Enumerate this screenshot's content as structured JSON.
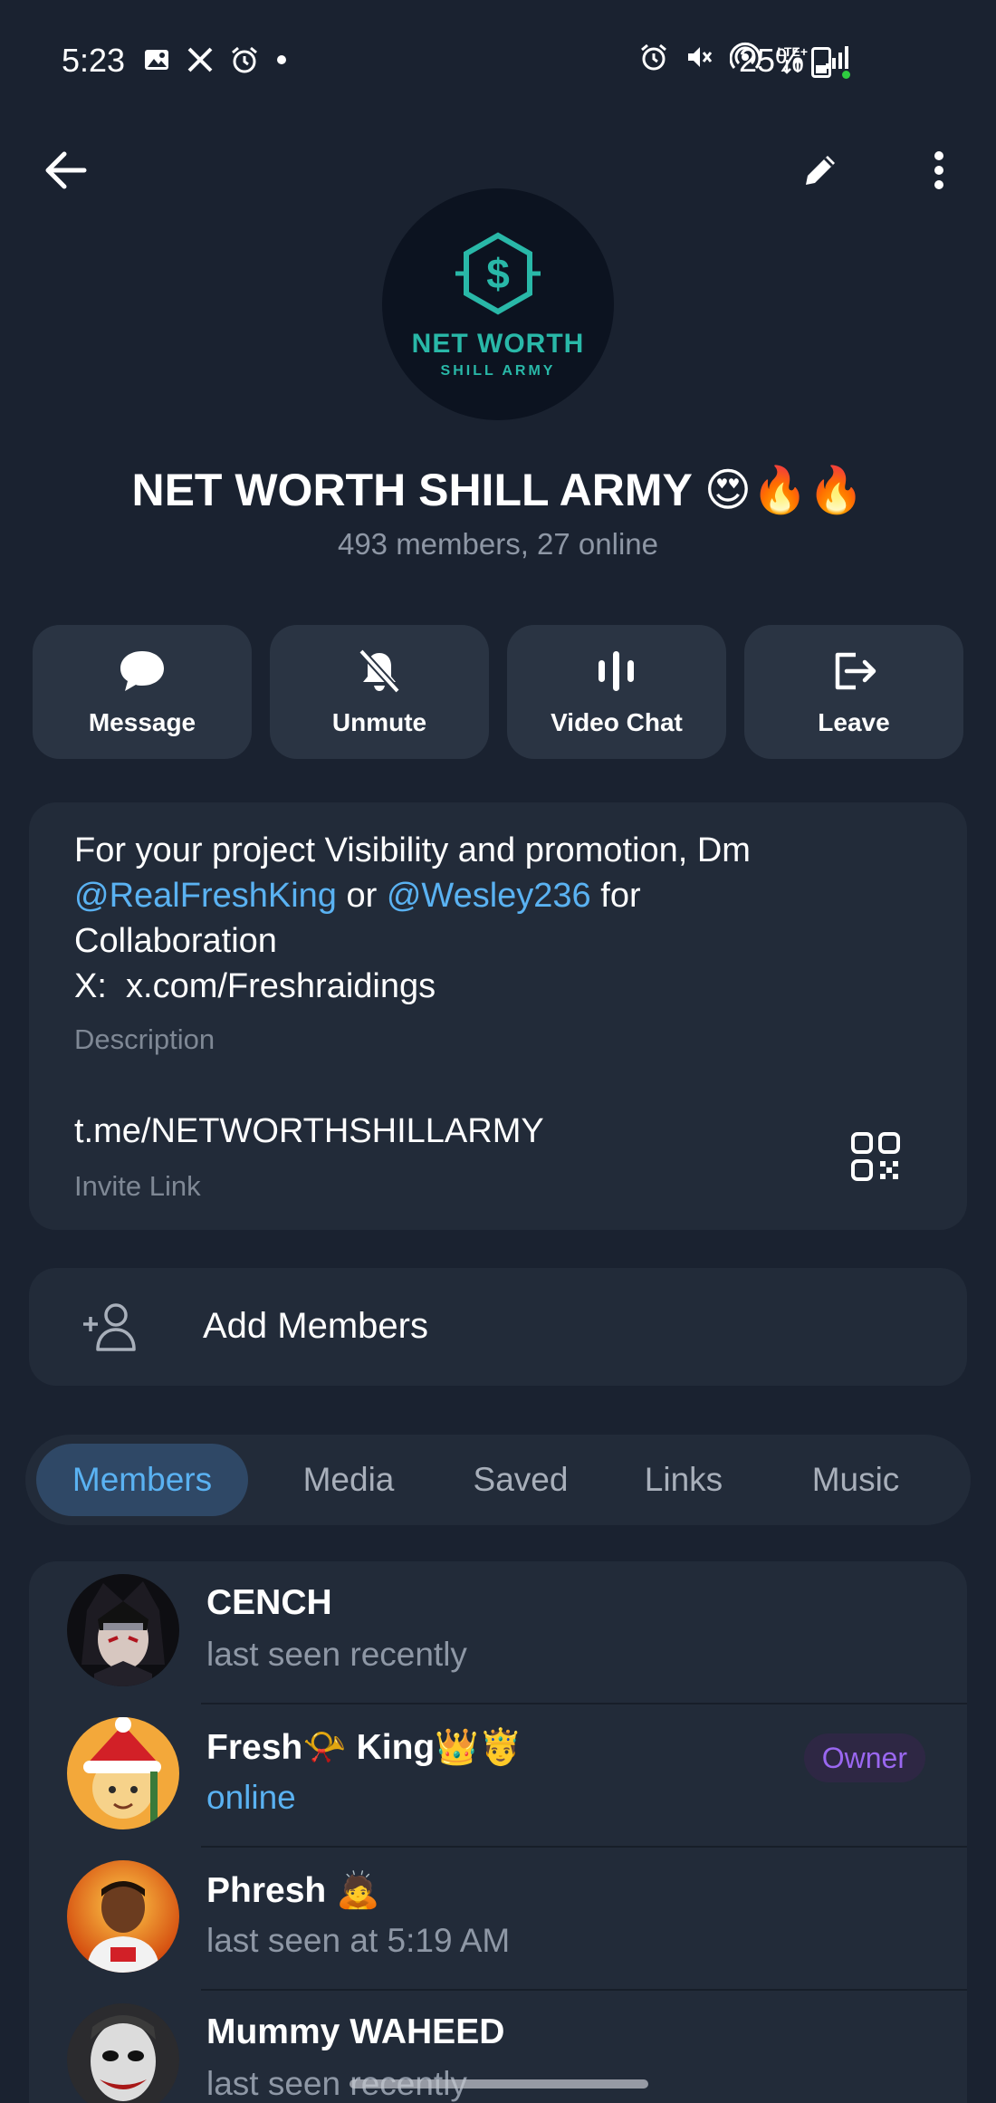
{
  "status_bar": {
    "time": "5:23",
    "battery": "25%",
    "left_icons": [
      "gallery-icon",
      "x-icon",
      "alarm-icon",
      "dot-icon"
    ],
    "right_icons": [
      "alarm-icon",
      "mute-icon",
      "hotspot-icon",
      "lte-icon",
      "signal-icon",
      "battery-icon"
    ],
    "lte_label": "LTE+"
  },
  "header": {
    "back_icon": "back-arrow-icon",
    "edit_icon": "pencil-icon",
    "more_icon": "more-vertical-icon"
  },
  "group": {
    "avatar_text": "NET WORTH",
    "avatar_subtext": "SHILL ARMY",
    "title": "NET WORTH SHILL ARMY 😍🔥🔥",
    "subtitle": "493 members, 27 online"
  },
  "actions": [
    {
      "label": "Message",
      "icon": "chat-bubble-icon"
    },
    {
      "label": "Unmute",
      "icon": "bell-off-icon"
    },
    {
      "label": "Video Chat",
      "icon": "voice-bars-icon"
    },
    {
      "label": "Leave",
      "icon": "logout-icon"
    }
  ],
  "info": {
    "desc_line1": "For your project Visibility and promotion, Dm",
    "mention1": "@RealFreshKing",
    "or": " or ",
    "mention2": "@Wesley236",
    "for": " for",
    "desc_line3": "Collaboration",
    "desc_line4": "X:  x.com/Freshraidings",
    "desc_caption": "Description",
    "invite_link": "t.me/NETWORTHSHILLARMY",
    "invite_caption": "Invite Link"
  },
  "add_members": {
    "label": "Add Members",
    "icon": "add-user-icon"
  },
  "tabs": [
    {
      "label": "Members",
      "active": true
    },
    {
      "label": "Media",
      "active": false
    },
    {
      "label": "Saved",
      "active": false
    },
    {
      "label": "Links",
      "active": false
    },
    {
      "label": "Music",
      "active": false
    }
  ],
  "members": [
    {
      "name": "CENCH",
      "status": "last seen recently",
      "online": false,
      "badge": ""
    },
    {
      "name": "Fresh📯 King👑🤴",
      "status": "online",
      "online": true,
      "badge": "Owner"
    },
    {
      "name": "Phresh 🙇",
      "status": "last seen at 5:19 AM",
      "online": false,
      "badge": ""
    },
    {
      "name": "Mummy WAHEED",
      "status": "last seen recently",
      "online": false,
      "badge": ""
    }
  ],
  "colors": {
    "background": "#1a2230",
    "card": "#222b39",
    "accent": "#5ab2f2",
    "owner_badge": "#9a67f0",
    "avatar_teal": "#29b8a8"
  }
}
